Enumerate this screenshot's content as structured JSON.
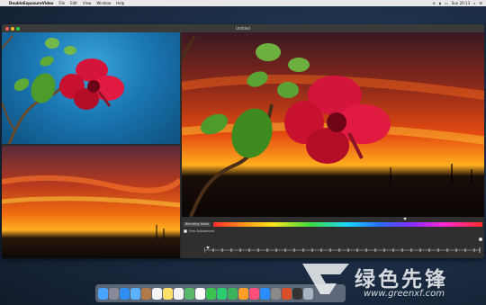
{
  "menubar": {
    "apple_icon": "apple-icon",
    "app_name": "DoubleExposureVideo",
    "items": [
      "File",
      "Edit",
      "View",
      "Window",
      "Help"
    ],
    "clock": "Sun 20:13"
  },
  "window": {
    "title": "Untitled",
    "traffic_colors": [
      "#ff5f57",
      "#febc2e",
      "#28c840"
    ]
  },
  "controls": {
    "blend_label": "Blending Mode",
    "checkbox_label": "Fine Adjustment"
  },
  "dock": {
    "icons": [
      "finder-icon",
      "launchpad-icon",
      "safari-icon",
      "mail-icon",
      "contacts-icon",
      "calendar-icon",
      "notes-icon",
      "reminders-icon",
      "maps-icon",
      "photos-icon",
      "messages-icon",
      "facetime-icon",
      "numbers-icon",
      "keynote-icon",
      "itunes-icon",
      "appstore-icon",
      "preferences-icon",
      "app-icon",
      "terminal-icon",
      "trash-icon"
    ],
    "colors": [
      "#4aa3ff",
      "#8a8a9a",
      "#2f8cf0",
      "#5ab2ff",
      "#b07a4a",
      "#f4f4f4",
      "#ffe06a",
      "#f3f3f3",
      "#58b86a",
      "#ffffff",
      "#3cc34f",
      "#2ecc71",
      "#3bb35a",
      "#ff9f2a",
      "#ff4f7a",
      "#2a8cff",
      "#8a8a8a",
      "#d94f2a",
      "#333333",
      "#a9b3c0"
    ]
  },
  "watermark": {
    "text": "绿色先锋",
    "url": "www.greenxf.com"
  },
  "colors": {
    "accent": "#1ad6ff"
  }
}
